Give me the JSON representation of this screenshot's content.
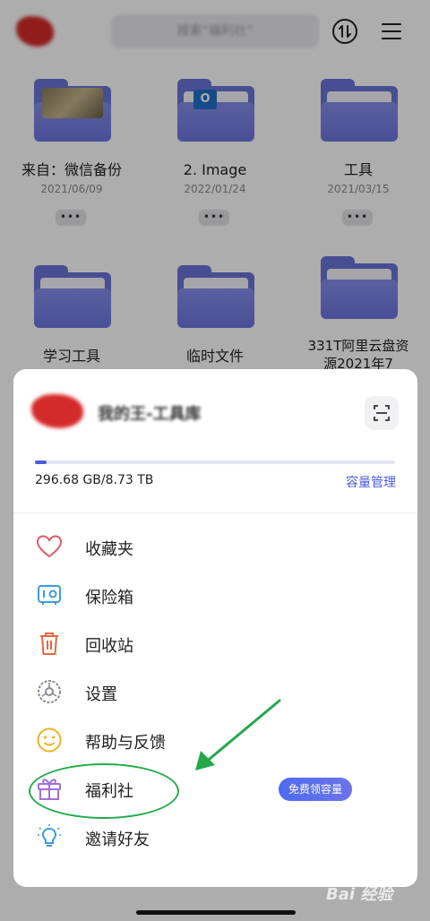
{
  "header": {
    "search_placeholder": "搜索“福利社”"
  },
  "files": [
    {
      "name": "来自：微信备份",
      "date": "2021/06/09",
      "thumb": "photo"
    },
    {
      "name": "2. Image",
      "date": "2022/01/24",
      "thumb": "outlook"
    },
    {
      "name": "工具",
      "date": "2021/03/15",
      "thumb": "none"
    },
    {
      "name": "学习工具",
      "date": "",
      "thumb": "none"
    },
    {
      "name": "临时文件",
      "date": "",
      "thumb": "none"
    },
    {
      "name": "331T阿里云盘资源2021年7",
      "date": "",
      "thumb": "none"
    }
  ],
  "more_glyph": "•••",
  "account": {
    "name": "我的王-工具库"
  },
  "storage": {
    "used_label": "296.68 GB/8.73 TB",
    "used_fraction": 0.033,
    "manage_label": "容量管理"
  },
  "menu": [
    {
      "label": "收藏夹",
      "icon": "heart-icon"
    },
    {
      "label": "保险箱",
      "icon": "safe-icon"
    },
    {
      "label": "回收站",
      "icon": "trash-icon"
    },
    {
      "label": "设置",
      "icon": "gear-icon"
    },
    {
      "label": "帮助与反馈",
      "icon": "smiley-icon"
    },
    {
      "label": "福利社",
      "icon": "gift-icon",
      "badge": "免费领容量"
    },
    {
      "label": "邀请好友",
      "icon": "lightbulb-icon"
    }
  ],
  "watermark": "Bai 经验",
  "colors": {
    "accent": "#4a5bdc",
    "folder": "#6b73d8",
    "annotation": "#23a94a"
  }
}
